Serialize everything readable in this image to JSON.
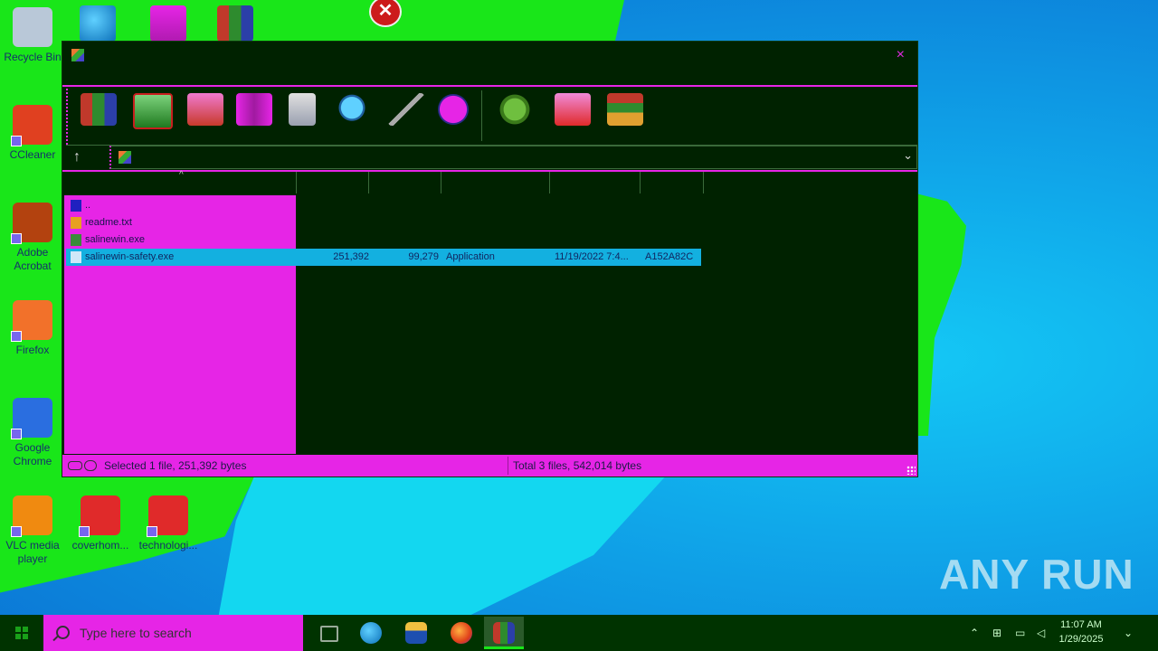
{
  "desktop": {
    "icons": [
      {
        "label": "Recycle Bin",
        "icon": "recycle-bin-icon",
        "color": "#b9c8d8"
      },
      {
        "label": "CCleaner",
        "icon": "ccleaner-icon",
        "color": "#e04020"
      },
      {
        "label": "Adobe Acrobat",
        "icon": "acrobat-icon",
        "color": "#b3420f"
      },
      {
        "label": "Firefox",
        "icon": "firefox-icon",
        "color": "#f2712a"
      },
      {
        "label": "Google Chrome",
        "icon": "chrome-icon",
        "color": "#2a6ee0"
      },
      {
        "label": "VLC media player",
        "icon": "vlc-icon",
        "color": "#f08a10"
      },
      {
        "label": "coverhom...",
        "icon": "word-doc-icon",
        "color": "#e02a2a"
      },
      {
        "label": "technologi...",
        "icon": "word-doc-icon",
        "color": "#e02a2a"
      }
    ],
    "watermark": "ANY RUN"
  },
  "window": {
    "close_label": "×",
    "toolbar_icons": [
      "add-icon",
      "extract-icon",
      "test-icon",
      "view-icon",
      "delete-icon",
      "find-icon",
      "wizard-icon",
      "info-icon",
      "virusscan-icon",
      "comment-icon",
      "sfx-icon"
    ],
    "status": {
      "left": "Selected 1 file, 251,392 bytes",
      "right": "Total 3 files, 542,014 bytes"
    },
    "files": [
      {
        "name": "..",
        "size": "",
        "packed": "",
        "type": "",
        "modified": "",
        "crc": "",
        "selected": false,
        "icon_color": "#2020c0"
      },
      {
        "name": "readme.txt",
        "size": "",
        "packed": "",
        "type": "",
        "modified": "",
        "crc": "",
        "selected": false,
        "icon_color": "#e8a020"
      },
      {
        "name": "salinewin.exe",
        "size": "",
        "packed": "",
        "type": "",
        "modified": "",
        "crc": "",
        "selected": false,
        "icon_color": "#3a8a3a"
      },
      {
        "name": "salinewin-safety.exe",
        "size": "251,392",
        "packed": "99,279",
        "type": "Application",
        "modified": "11/19/2022 7:4...",
        "crc": "A152A82C",
        "selected": true,
        "icon_color": "#d0e8f8"
      }
    ]
  },
  "taskbar": {
    "search_placeholder": "Type here to search",
    "apps": [
      "task-view-icon",
      "edge-icon",
      "file-explorer-icon",
      "firefox-icon",
      "winrar-icon"
    ],
    "clock_time": "11:07 AM",
    "clock_date": "1/29/2025"
  }
}
